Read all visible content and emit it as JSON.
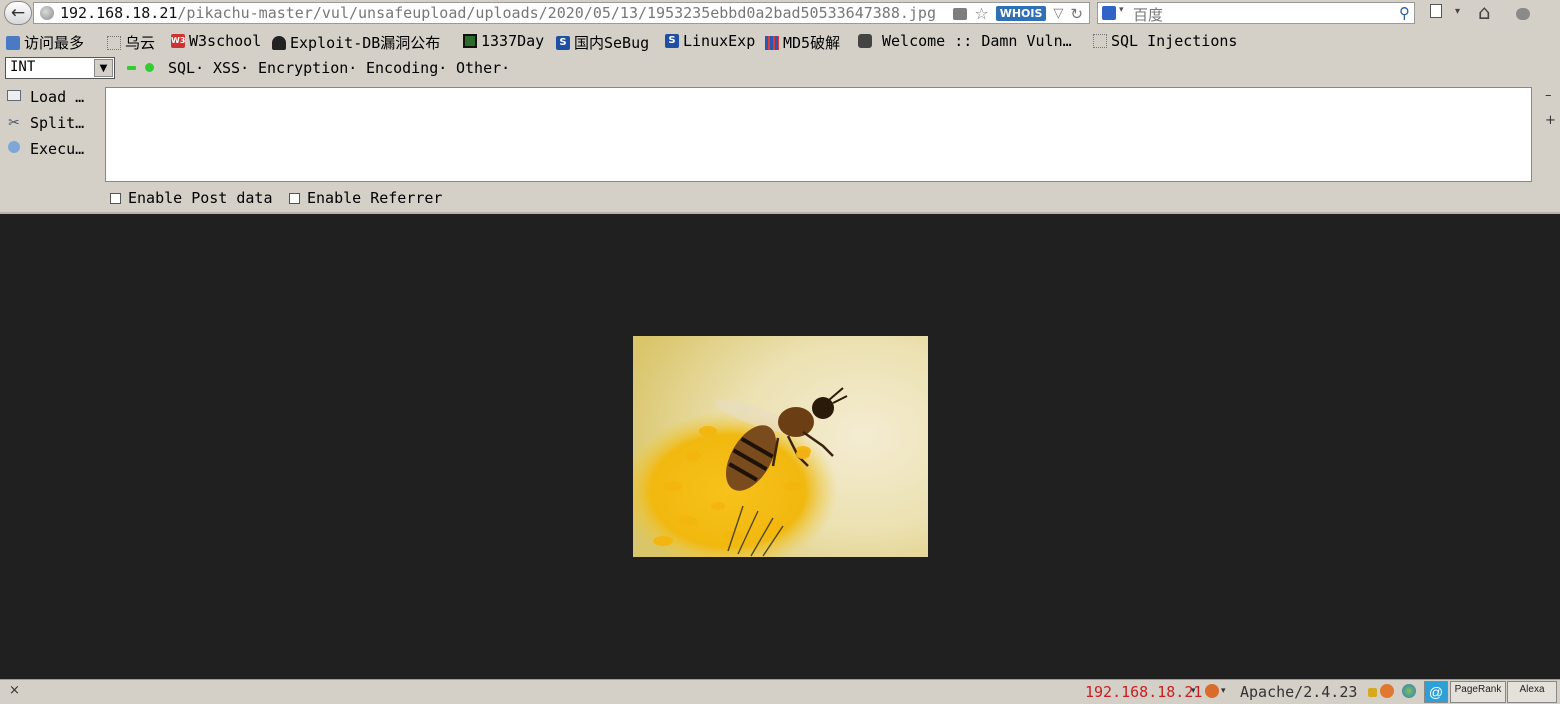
{
  "nav": {
    "back_glyph": "←",
    "url_host": "192.168.18.21",
    "url_path": "/pikachu-master/vul/unsafeupload/uploads/2020/05/13/1953235ebbd0a2bad50533647388.jpg",
    "whois_label": "WHOIS",
    "star_glyph": "☆",
    "dropdown_glyph": "▽",
    "reload_glyph": "↻",
    "search_engine_drop": "▾",
    "search_placeholder": "百度",
    "search_glyph": "⚲",
    "home_glyph": "⌂"
  },
  "bookmarks": [
    {
      "label": "访问最多"
    },
    {
      "label": "乌云"
    },
    {
      "label": "W3school",
      "icon_text": "W3"
    },
    {
      "label": "Exploit-DB漏洞公布"
    },
    {
      "label": "1337Day"
    },
    {
      "label": "国内SeBug",
      "icon_text": "S"
    },
    {
      "label": "LinuxExp",
      "icon_text": "S"
    },
    {
      "label": "MD5破解"
    },
    {
      "label": "Welcome :: Damn Vuln…"
    },
    {
      "label": "SQL Injections"
    }
  ],
  "hackbar": {
    "select_value": "INT",
    "select_arrow": "▼",
    "menus": [
      "SQL·",
      "XSS·",
      "Encryption·",
      "Encoding·",
      "Other·"
    ],
    "buttons": [
      {
        "label": "Load …",
        "icon": "load-url-icon"
      },
      {
        "label": "Split…",
        "icon": "split-url-icon"
      },
      {
        "label": "Execu…",
        "icon": "execute-icon"
      }
    ],
    "textarea_value": "",
    "zoom_out": "–",
    "zoom_in": "+",
    "enable_post_label": "Enable Post data",
    "enable_referrer_label": "Enable Referrer"
  },
  "content": {
    "background_color": "#202020",
    "image_subject": "bee"
  },
  "status": {
    "close_glyph": "×",
    "ip": "192.168.18.21",
    "drop_glyph": "▾",
    "server": "Apache/2.4.23",
    "pagerank_label": "PageRank",
    "alexa_label": "Alexa",
    "at_glyph": "@"
  },
  "colors": {
    "chrome": "#d4d0c8",
    "ip_red": "#c82020",
    "whois_blue": "#2f6fb5"
  }
}
